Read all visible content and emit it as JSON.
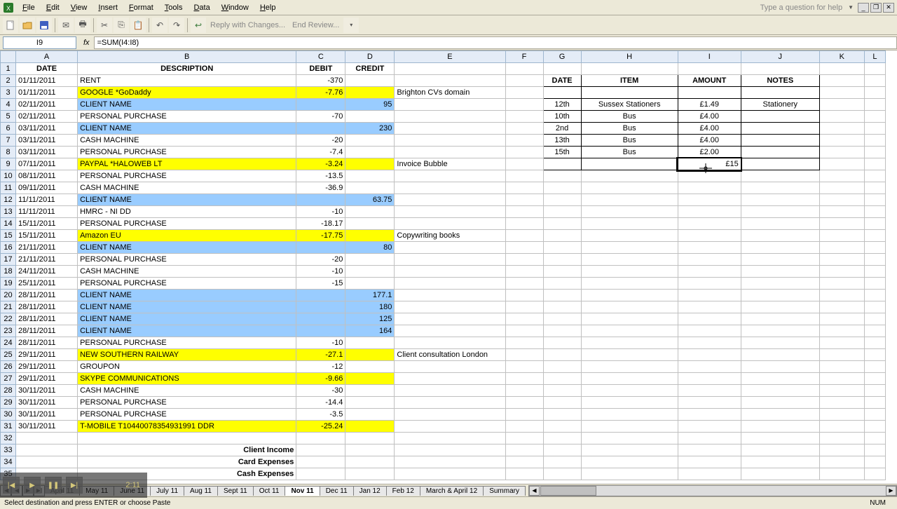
{
  "menu": {
    "items": [
      "File",
      "Edit",
      "View",
      "Insert",
      "Format",
      "Tools",
      "Data",
      "Window",
      "Help"
    ],
    "help_placeholder": "Type a question for help"
  },
  "toolbar": {
    "reply": "Reply with Changes...",
    "end": "End Review..."
  },
  "formula_bar": {
    "name_box": "I9",
    "fx": "fx",
    "formula": "=SUM(I4:I8)"
  },
  "columns": [
    "A",
    "B",
    "C",
    "D",
    "E",
    "F",
    "G",
    "H",
    "I",
    "J",
    "K",
    "L"
  ],
  "headers_main": {
    "A": "DATE",
    "B": "DESCRIPTION",
    "C": "DEBIT",
    "D": "CREDIT"
  },
  "headers_side": {
    "G": "DATE",
    "H": "ITEM",
    "I": "AMOUNT",
    "J": "NOTES"
  },
  "rows": [
    {
      "r": 2,
      "A": "01/11/2011",
      "B": "RENT",
      "C": "-370"
    },
    {
      "r": 3,
      "A": "01/11/2011",
      "B": "GOOGLE *GoDaddy",
      "C": "-7.76",
      "E": "Brighton CVs domain",
      "cls": "hl-yellow"
    },
    {
      "r": 4,
      "A": "02/11/2011",
      "B": "CLIENT NAME",
      "D": "95",
      "cls": "hl-blue",
      "G": "12th",
      "H": "Sussex Stationers",
      "I": "£1.49",
      "J": "Stationery"
    },
    {
      "r": 5,
      "A": "02/11/2011",
      "B": "PERSONAL PURCHASE",
      "C": "-70",
      "G": "10th",
      "H": "Bus",
      "I": "£4.00"
    },
    {
      "r": 6,
      "A": "03/11/2011",
      "B": "CLIENT NAME",
      "D": "230",
      "cls": "hl-blue",
      "G": "2nd",
      "H": "Bus",
      "I": "£4.00"
    },
    {
      "r": 7,
      "A": "03/11/2011",
      "B": "CASH MACHINE",
      "C": "-20",
      "G": "13th",
      "H": "Bus",
      "I": "£4.00"
    },
    {
      "r": 8,
      "A": "03/11/2011",
      "B": "PERSONAL PURCHASE",
      "C": "-7.4",
      "G": "15th",
      "H": "Bus",
      "I": "£2.00"
    },
    {
      "r": 9,
      "A": "07/11/2011",
      "B": "PAYPAL *HALOWEB LT",
      "C": "-3.24",
      "E": "Invoice Bubble",
      "cls": "hl-yellow",
      "I": "£15",
      "side_hl": true
    },
    {
      "r": 10,
      "A": "08/11/2011",
      "B": "PERSONAL PURCHASE",
      "C": "-13.5"
    },
    {
      "r": 11,
      "A": "09/11/2011",
      "B": "CASH MACHINE",
      "C": "-36.9"
    },
    {
      "r": 12,
      "A": "11/11/2011",
      "B": "CLIENT NAME",
      "D": "63.75",
      "cls": "hl-blue"
    },
    {
      "r": 13,
      "A": "11/11/2011",
      "B": "HMRC - NI DD",
      "C": "-10"
    },
    {
      "r": 14,
      "A": "15/11/2011",
      "B": "PERSONAL PURCHASE",
      "C": "-18.17"
    },
    {
      "r": 15,
      "A": "15/11/2011",
      "B": "Amazon EU",
      "C": "-17.75",
      "E": "Copywriting books",
      "cls": "hl-yellow"
    },
    {
      "r": 16,
      "A": "21/11/2011",
      "B": "CLIENT NAME",
      "D": "80",
      "cls": "hl-blue"
    },
    {
      "r": 17,
      "A": "21/11/2011",
      "B": "PERSONAL PURCHASE",
      "C": "-20"
    },
    {
      "r": 18,
      "A": "24/11/2011",
      "B": "CASH MACHINE",
      "C": "-10"
    },
    {
      "r": 19,
      "A": "25/11/2011",
      "B": "PERSONAL PURCHASE",
      "C": "-15"
    },
    {
      "r": 20,
      "A": "28/11/2011",
      "B": "CLIENT NAME",
      "D": "177.1",
      "cls": "hl-blue"
    },
    {
      "r": 21,
      "A": "28/11/2011",
      "B": "CLIENT NAME",
      "D": "180",
      "cls": "hl-blue"
    },
    {
      "r": 22,
      "A": "28/11/2011",
      "B": "CLIENT NAME",
      "D": "125",
      "cls": "hl-blue"
    },
    {
      "r": 23,
      "A": "28/11/2011",
      "B": "CLIENT NAME",
      "D": "164",
      "cls": "hl-blue"
    },
    {
      "r": 24,
      "A": "28/11/2011",
      "B": "PERSONAL PURCHASE",
      "C": "-10"
    },
    {
      "r": 25,
      "A": "29/11/2011",
      "B": "NEW SOUTHERN RAILWAY",
      "C": "-27.1",
      "E": "Client consultation London",
      "cls": "hl-yellow"
    },
    {
      "r": 26,
      "A": "29/11/2011",
      "B": "GROUPON",
      "C": "-12"
    },
    {
      "r": 27,
      "A": "29/11/2011",
      "B": "SKYPE COMMUNICATIONS",
      "C": "-9.66",
      "cls": "hl-yellow"
    },
    {
      "r": 28,
      "A": "30/11/2011",
      "B": "CASH MACHINE",
      "C": "-30"
    },
    {
      "r": 29,
      "A": "30/11/2011",
      "B": "PERSONAL PURCHASE",
      "C": "-14.4"
    },
    {
      "r": 30,
      "A": "30/11/2011",
      "B": "PERSONAL PURCHASE",
      "C": "-3.5"
    },
    {
      "r": 31,
      "A": "30/11/2011",
      "B": "T-MOBILE          T10440078354931991 DDR",
      "C": "-25.24",
      "cls": "hl-yellow"
    },
    {
      "r": 32
    },
    {
      "r": 33,
      "B": "Client Income",
      "Bbold": true
    },
    {
      "r": 34,
      "B": "Card Expenses",
      "Bbold": true
    },
    {
      "r": 35,
      "B": "Cash Expenses",
      "Bbold": true
    }
  ],
  "tabs": [
    "April 11",
    "May 11",
    "June 11",
    "July 11",
    "Aug 11",
    "Sept 11",
    "Oct 11",
    "Nov 11",
    "Dec 11",
    "Jan 12",
    "Feb 12",
    "March & April 12",
    "Summary"
  ],
  "active_tab": "Nov 11",
  "status": {
    "left": "Select destination and press ENTER or choose Paste",
    "num": "NUM"
  },
  "media": {
    "time": "2:11"
  }
}
